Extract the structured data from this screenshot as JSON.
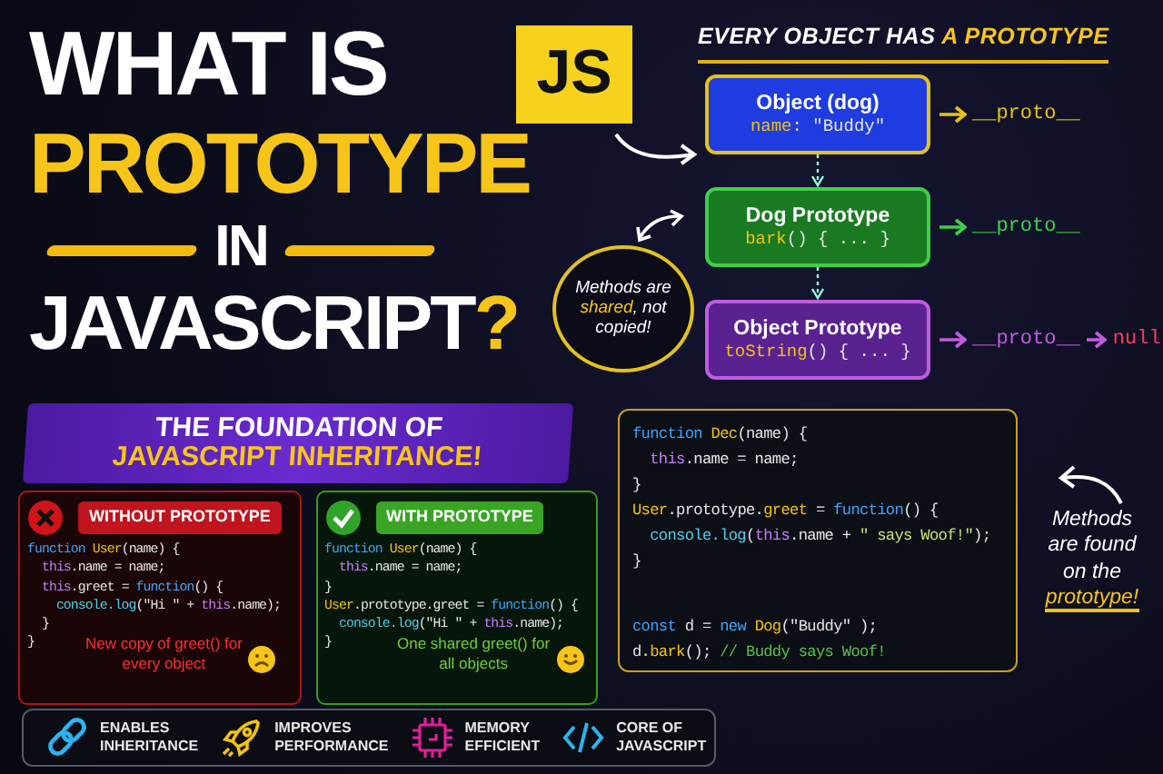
{
  "title": {
    "lines": [
      {
        "parts": [
          {
            "text": "WHAT IS",
            "accent": false
          }
        ]
      },
      {
        "parts": [
          {
            "text": "PROTOTYPE",
            "accent": true
          }
        ]
      },
      {
        "parts": [
          {
            "text": "IN",
            "accent": false
          }
        ]
      },
      {
        "parts": [
          {
            "text": "JAVASCRIPT",
            "accent": false
          },
          {
            "text": "?",
            "accent": true
          }
        ]
      }
    ]
  },
  "logo": {
    "text": "JS"
  },
  "subtitle": {
    "lines": [
      {
        "text": "THE FOUNDATION OF",
        "accent": false
      },
      {
        "text": "JAVASCRIPT INHERITANCE!",
        "accent": true
      }
    ]
  },
  "diagram": {
    "heading": [
      {
        "text": "EVERY OBJECT HAS ",
        "accent": false
      },
      {
        "text": "A PROTOTYPE",
        "accent": true
      }
    ],
    "nodes": [
      {
        "title": "Object (dog)",
        "color": "#1f3ce0",
        "member": [
          {
            "kind": "fn",
            "text": "name"
          },
          {
            "kind": "plain",
            "text": ": \"Buddy\""
          }
        ],
        "proto": {
          "text": "__proto__",
          "color": "#e3c21a"
        }
      },
      {
        "title": "Dog Prototype",
        "color": "#1a7a22",
        "member": [
          {
            "kind": "fn",
            "text": "bark"
          },
          {
            "kind": "plain",
            "text": "() { ... }"
          }
        ],
        "proto": {
          "text": "__proto__",
          "color": "#3ecf4a"
        }
      },
      {
        "title": "Object Prototype",
        "color": "#5a2290",
        "member": [
          {
            "kind": "fn",
            "text": "toString"
          },
          {
            "kind": "plain",
            "text": "() { ... }"
          }
        ],
        "proto": {
          "text": "__proto__",
          "color": "#c05ce0",
          "next": "null"
        }
      }
    ],
    "callout": [
      {
        "text": "Methods are ",
        "accent": false
      },
      {
        "text": "shared",
        "accent": true
      },
      {
        "text": ", not copied!",
        "accent": false
      }
    ]
  },
  "cards": [
    {
      "kind": "bad",
      "title": "WITHOUT PROTOTYPE",
      "lines": [
        [
          {
            "kind": "kw",
            "text": "function "
          },
          {
            "kind": "fn",
            "text": "User"
          },
          {
            "kind": "plain",
            "text": "(name) {"
          }
        ],
        [
          {
            "kind": "this",
            "text": "  this"
          },
          {
            "kind": "plain",
            "text": ".name = name;"
          }
        ],
        [
          {
            "kind": "this",
            "text": "  this"
          },
          {
            "kind": "plain",
            "text": ".greet = "
          },
          {
            "kind": "kw",
            "text": "function"
          },
          {
            "kind": "plain",
            "text": "() {"
          }
        ],
        [
          {
            "kind": "call",
            "text": "    console.log"
          },
          {
            "kind": "plain",
            "text": "(\"Hi \" + "
          },
          {
            "kind": "this",
            "text": "this"
          },
          {
            "kind": "plain",
            "text": ".name);"
          }
        ],
        [
          {
            "kind": "plain",
            "text": "  }"
          }
        ],
        [
          {
            "kind": "plain",
            "text": "}"
          }
        ]
      ],
      "note": "New copy of greet() for\nevery object"
    },
    {
      "kind": "good",
      "title": "WITH PROTOTYPE",
      "lines": [
        [
          {
            "kind": "kw",
            "text": "function "
          },
          {
            "kind": "fn",
            "text": "User"
          },
          {
            "kind": "plain",
            "text": "(name) {"
          }
        ],
        [
          {
            "kind": "this",
            "text": "  this"
          },
          {
            "kind": "plain",
            "text": ".name = name;"
          }
        ],
        [
          {
            "kind": "plain",
            "text": "}"
          }
        ],
        [
          {
            "kind": "fn",
            "text": "User"
          },
          {
            "kind": "plain",
            "text": ".prototype.greet = "
          },
          {
            "kind": "kw",
            "text": "function"
          },
          {
            "kind": "plain",
            "text": "() {"
          }
        ],
        [
          {
            "kind": "call",
            "text": "  console.log"
          },
          {
            "kind": "plain",
            "text": "(\"Hi \" + "
          },
          {
            "kind": "this",
            "text": "this"
          },
          {
            "kind": "plain",
            "text": ".name);"
          }
        ],
        [
          {
            "kind": "plain",
            "text": "}"
          }
        ]
      ],
      "note": "One shared greet() for\nall objects"
    }
  ],
  "code_panel": {
    "blocks": [
      [
        [
          {
            "kind": "kw",
            "text": "function "
          },
          {
            "kind": "fn",
            "text": "Dec"
          },
          {
            "kind": "plain",
            "text": "(name) {"
          }
        ],
        [
          {
            "kind": "this",
            "text": "  this"
          },
          {
            "kind": "plain",
            "text": ".name = name;"
          }
        ],
        [
          {
            "kind": "plain",
            "text": "}"
          }
        ],
        [
          {
            "kind": "fn",
            "text": "User"
          },
          {
            "kind": "plain",
            "text": ".prototype."
          },
          {
            "kind": "fn",
            "text": "greet"
          },
          {
            "kind": "plain",
            "text": " = "
          },
          {
            "kind": "kw",
            "text": "function"
          },
          {
            "kind": "plain",
            "text": "() {"
          }
        ],
        [
          {
            "kind": "call",
            "text": "  console.log"
          },
          {
            "kind": "plain",
            "text": "("
          },
          {
            "kind": "this",
            "text": "this"
          },
          {
            "kind": "plain",
            "text": ".name + "
          },
          {
            "kind": "str",
            "text": "\" says Woof!\""
          },
          {
            "kind": "plain",
            "text": ");"
          }
        ],
        [
          {
            "kind": "plain",
            "text": "}"
          }
        ]
      ],
      [
        [
          {
            "kind": "kw",
            "text": "const "
          },
          {
            "kind": "plain",
            "text": "d = "
          },
          {
            "kind": "kw",
            "text": "new "
          },
          {
            "kind": "fn",
            "text": "Dog"
          },
          {
            "kind": "plain",
            "text": "(\"Buddy\" );"
          }
        ],
        [
          {
            "kind": "plain",
            "text": "d."
          },
          {
            "kind": "fn",
            "text": "bark"
          },
          {
            "kind": "plain",
            "text": "(); "
          },
          {
            "kind": "com",
            "text": "// Buddy says Woof!"
          }
        ]
      ]
    ],
    "note": [
      {
        "text": "Methods\nare found\non the\n",
        "accent": false
      },
      {
        "text": "prototype!",
        "accent": true
      }
    ]
  },
  "features": [
    {
      "label": "ENABLES\nINHERITANCE"
    },
    {
      "label": "IMPROVES\nPERFORMANCE"
    },
    {
      "label": "MEMORY\nEFFICIENT"
    },
    {
      "label": "CORE OF\nJAVASCRIPT"
    }
  ]
}
